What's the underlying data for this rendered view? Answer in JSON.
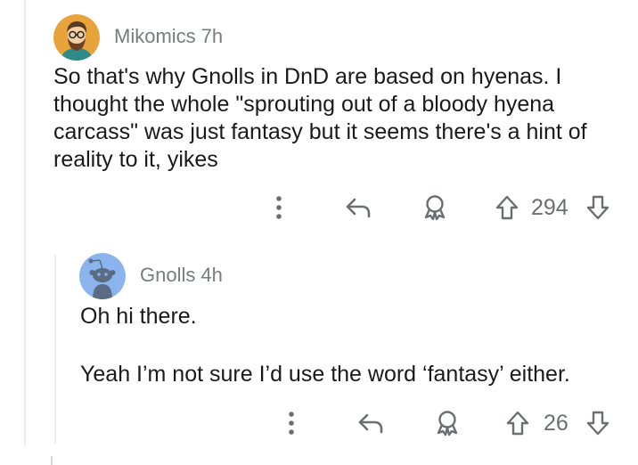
{
  "comment": {
    "author": "Mikomics",
    "time": "7h",
    "body": "So that's why Gnolls in DnD are based on hyenas. I thought the whole \"sprouting out of a bloody hyena carcass\" was just fantasy but it seems there's a hint of reality to it, yikes",
    "score": "294",
    "avatar_icon": "bearded-man-avatar-icon"
  },
  "reply": {
    "author": "Gnolls",
    "time": "4h",
    "body_lines": [
      "Oh hi there.",
      "Yeah I’m not sure I’d use the word ‘fantasy’ either."
    ],
    "score": "26",
    "avatar_icon": "snoo-avatar-icon"
  },
  "icons": {
    "more": "more-options-icon",
    "reply": "reply-arrow-icon",
    "award": "award-icon",
    "upvote": "upvote-arrow-icon",
    "downvote": "downvote-arrow-icon"
  },
  "colors": {
    "meta_text": "#787c7e",
    "icon": "#6b6f72",
    "snoo_bg": "#8bb3ee",
    "avatar_bg": "#e8a33a"
  }
}
